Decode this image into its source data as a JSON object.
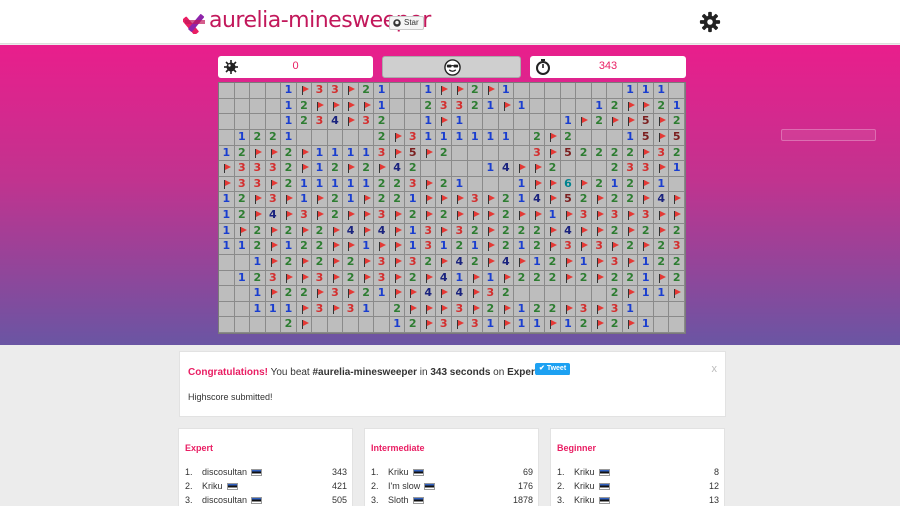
{
  "header": {
    "logo_text": "aurelia-minesweeper",
    "star_label": "Star",
    "icons": {
      "logo": "aurelia-logo-icon",
      "star_github": "github-icon",
      "settings": "gear-icon"
    }
  },
  "game": {
    "mines_left": "0",
    "time": "343",
    "icons": {
      "mine": "mine-icon",
      "face": "sunglasses-face-icon",
      "timer": "stopwatch-icon"
    },
    "rows": [
      "....1F33F21..1FF2F1.......111.",
      "....12FFFF1..23321F1....12FF21",
      "....1234F32..1F1......1F2FF5F2",
      ".1221.....2F3111111.2F2...15F5",
      "12FF2F11113F5F2.....3F52222F32",
      "F3332F12F2F42....14FF2...233F1",
      "F33F211111223F21...1FF6F212F1.",
      "12F3F1F21F221FFF3F214F52F22F4F",
      "12F4F3F2FF3F2F2FFF2FF1F3F3F3FF",
      "1F2F2F2F4F4F13F32F222F4FF2F2F2",
      "112F122FF1FF13121F212F3F3F2F23",
      "..1F2F2F2F3F32F42F4F12F1F3F122",
      ".123FF3F2F3F2F41F1F222F2F221F2",
      "..1F22F3F21FF4F4F32......2F11F",
      "..111F3F31.2FFF3F2F122F3F31...",
      "....2F.....12F3F31F11F12F2F1.."
    ]
  },
  "colors": {
    "hero_top": "#e91e8c",
    "hero_bottom": "#6a55a3",
    "accent": "#e91e63"
  },
  "congrats": {
    "title": "Congratulations!",
    "pre": " You beat ",
    "game": "#aurelia-minesweeper",
    "mid": " in ",
    "seconds": "343 seconds",
    "mid2": " on ",
    "mode": "Expert mode",
    "end": "!",
    "tweet_label": "Tweet",
    "close_label": "x",
    "highscore": "Highscore submitted!"
  },
  "leaderboards": [
    {
      "title": "Expert",
      "entries": [
        {
          "rank": "1.",
          "name": "discosultan",
          "score": "343"
        },
        {
          "rank": "2.",
          "name": "Kriku",
          "score": "421"
        },
        {
          "rank": "3.",
          "name": "discosultan",
          "score": "505"
        }
      ]
    },
    {
      "title": "Intermediate",
      "entries": [
        {
          "rank": "1.",
          "name": "Kriku",
          "score": "69"
        },
        {
          "rank": "2.",
          "name": "I'm slow",
          "score": "176"
        },
        {
          "rank": "3.",
          "name": "Sloth",
          "score": "1878"
        }
      ]
    },
    {
      "title": "Beginner",
      "entries": [
        {
          "rank": "1.",
          "name": "Kriku",
          "score": "8"
        },
        {
          "rank": "2.",
          "name": "Kriku",
          "score": "12"
        },
        {
          "rank": "3.",
          "name": "Kriku",
          "score": "13"
        }
      ]
    }
  ]
}
